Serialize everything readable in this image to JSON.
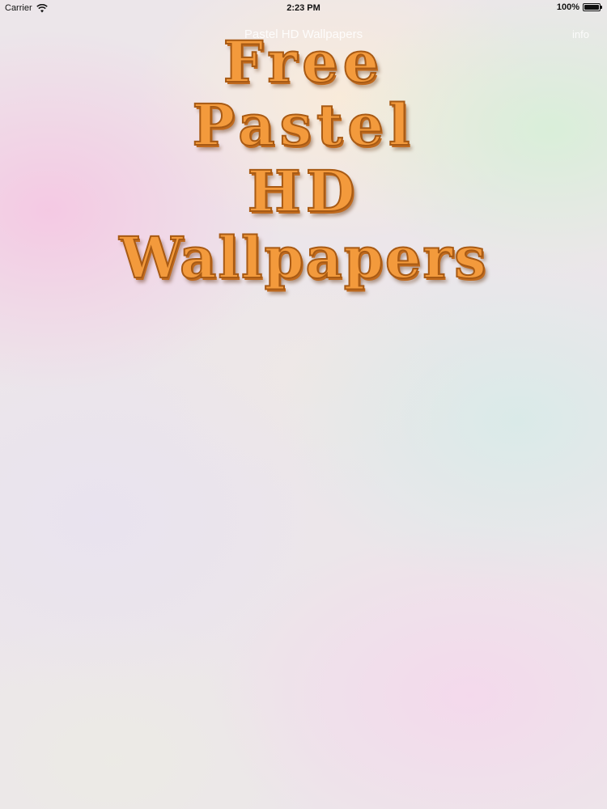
{
  "status_bar": {
    "carrier": "Carrier",
    "time": "2:23 PM",
    "battery_percent": "100%",
    "battery_level": 1.0,
    "wifi_icon": "wifi-icon",
    "battery_icon": "battery-icon"
  },
  "nav_bar": {
    "title": "Pastel HD Wallpapers",
    "info_label": "info"
  },
  "headline": {
    "lines": [
      "Free",
      "Pastel",
      "HD",
      "Wallpapers"
    ],
    "color": "#f39a3c",
    "outline_color": "#a85a14"
  }
}
